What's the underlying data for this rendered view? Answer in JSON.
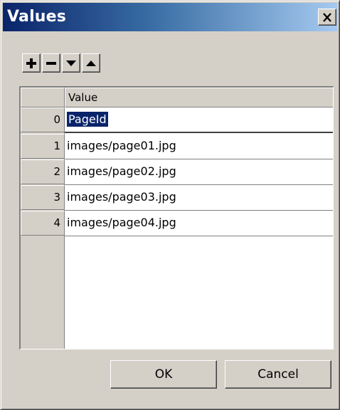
{
  "window": {
    "title": "Values",
    "close_glyph": "×"
  },
  "toolbar": {
    "buttons": [
      {
        "icon": "plus-icon",
        "action": "add"
      },
      {
        "icon": "minus-icon",
        "action": "remove"
      },
      {
        "icon": "arrow-down-icon",
        "action": "move-down"
      },
      {
        "icon": "arrow-up-icon",
        "action": "move-up"
      }
    ]
  },
  "grid": {
    "column_header": "Value",
    "rows": [
      {
        "index": "0",
        "value": "PageId",
        "selected": true
      },
      {
        "index": "1",
        "value": "images/page01.jpg"
      },
      {
        "index": "2",
        "value": "images/page02.jpg"
      },
      {
        "index": "3",
        "value": "images/page03.jpg"
      },
      {
        "index": "4",
        "value": "images/page04.jpg"
      }
    ]
  },
  "buttons": {
    "ok_label": "OK",
    "cancel_label": "Cancel"
  },
  "colors": {
    "title_gradient_start": "#0a246a",
    "title_gradient_end": "#a6caf0",
    "face": "#d4d0c8",
    "selection": "#0a246a"
  }
}
